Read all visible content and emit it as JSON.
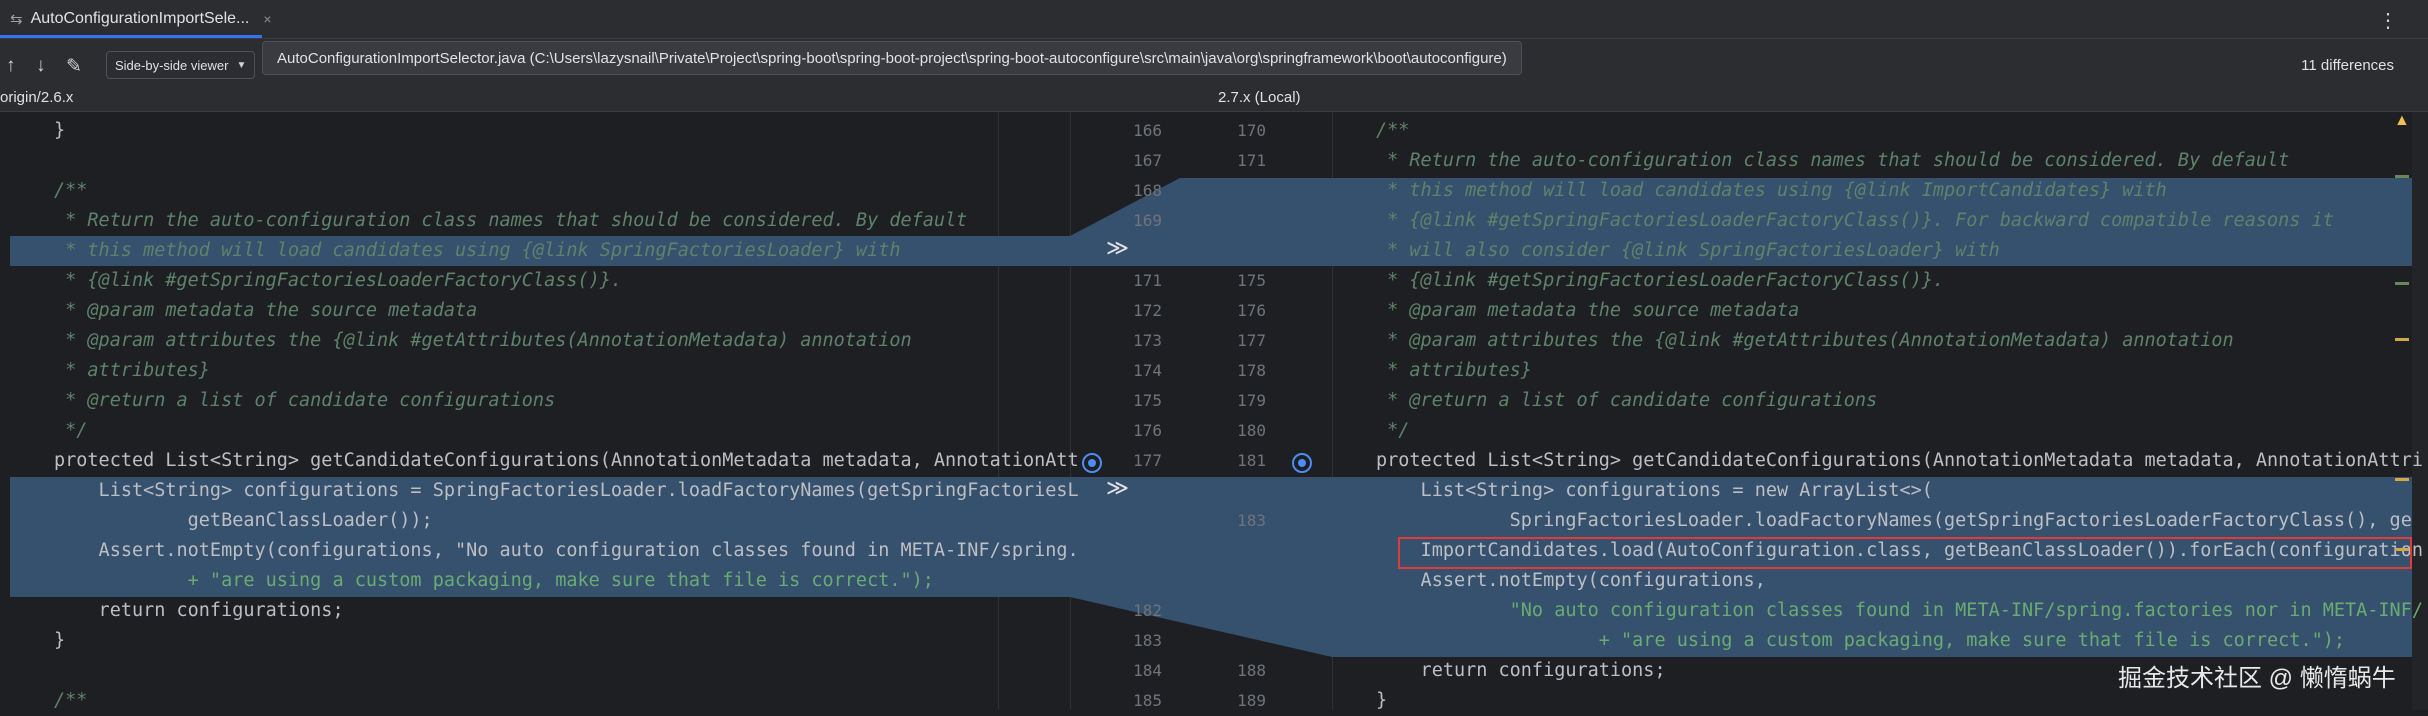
{
  "tab": {
    "icon": "diff-arrows-icon",
    "title": "AutoConfigurationImportSele...",
    "close": "×"
  },
  "toolbar": {
    "prev_icon": "↑",
    "next_icon": "↓",
    "edit_icon": "✎",
    "viewer_mode": "Side-by-side viewer",
    "path_tooltip": "AutoConfigurationImportSelector.java (C:\\Users\\lazysnail\\Private\\Project\\spring-boot\\spring-boot-project\\spring-boot-autoconfigure\\src\\main\\java\\org\\springframework\\boot\\autoconfigure)",
    "differences": "11 differences"
  },
  "headers": {
    "left": "origin/2.6.x",
    "right": "2.7.x (Local)"
  },
  "gutter": {
    "left_numbers": [
      "166",
      "167",
      "168",
      "169",
      "",
      "171",
      "172",
      "173",
      "174",
      "175",
      "176",
      "177",
      "",
      "",
      "",
      "",
      "182",
      "183",
      "184",
      "185"
    ],
    "right_numbers": [
      "170",
      "171",
      "",
      "",
      "",
      "175",
      "176",
      "177",
      "178",
      "179",
      "180",
      "181",
      "",
      "183",
      "",
      "",
      "",
      "",
      "188",
      "189"
    ]
  },
  "left_code": [
    "}",
    "",
    "/**",
    " * Return the auto-configuration class names that should be considered. By default",
    " * this method will load candidates using {@link SpringFactoriesLoader} with",
    " * {@link #getSpringFactoriesLoaderFactoryClass()}.",
    " * @param metadata the source metadata",
    " * @param attributes the {@link #getAttributes(AnnotationMetadata) annotation",
    " * attributes}",
    " * @return a list of candidate configurations",
    " */",
    "protected List<String> getCandidateConfigurations(AnnotationMetadata metadata, AnnotationAtt",
    "    List<String> configurations = SpringFactoriesLoader.loadFactoryNames(getSpringFactoriesL",
    "            getBeanClassLoader());",
    "    Assert.notEmpty(configurations, \"No auto configuration classes found in META-INF/spring.",
    "            + \"are using a custom packaging, make sure that file is correct.\");",
    "    return configurations;",
    "}",
    "",
    "/**"
  ],
  "right_code": [
    "/**",
    " * Return the auto-configuration class names that should be considered. By default",
    " * this method will load candidates using {@link ImportCandidates} with",
    " * {@link #getSpringFactoriesLoaderFactoryClass()}. For backward compatible reasons it",
    " * will also consider {@link SpringFactoriesLoader} with",
    " * {@link #getSpringFactoriesLoaderFactoryClass()}.",
    " * @param metadata the source metadata",
    " * @param attributes the {@link #getAttributes(AnnotationMetadata) annotation",
    " * attributes}",
    " * @return a list of candidate configurations",
    " */",
    "protected List<String> getCandidateConfigurations(AnnotationMetadata metadata, AnnotationAttri",
    "    List<String> configurations = new ArrayList<>(",
    "            SpringFactoriesLoader.loadFactoryNames(getSpringFactoriesLoaderFactoryClass(), ge",
    "    ImportCandidates.load(AutoConfiguration.class, getBeanClassLoader()).forEach(configuration",
    "    Assert.notEmpty(configurations,",
    "            \"No auto configuration classes found in META-INF/spring.factories nor in META-INF/",
    "                    + \"are using a custom packaging, make sure that file is correct.\");",
    "    return configurations;",
    "}"
  ],
  "watermark": "掘金技术社区 @ 懒惰蜗牛",
  "colors": {
    "changed_bg": "#36516d",
    "highlight_box": "#e03b3b",
    "accent": "#3574f0"
  }
}
